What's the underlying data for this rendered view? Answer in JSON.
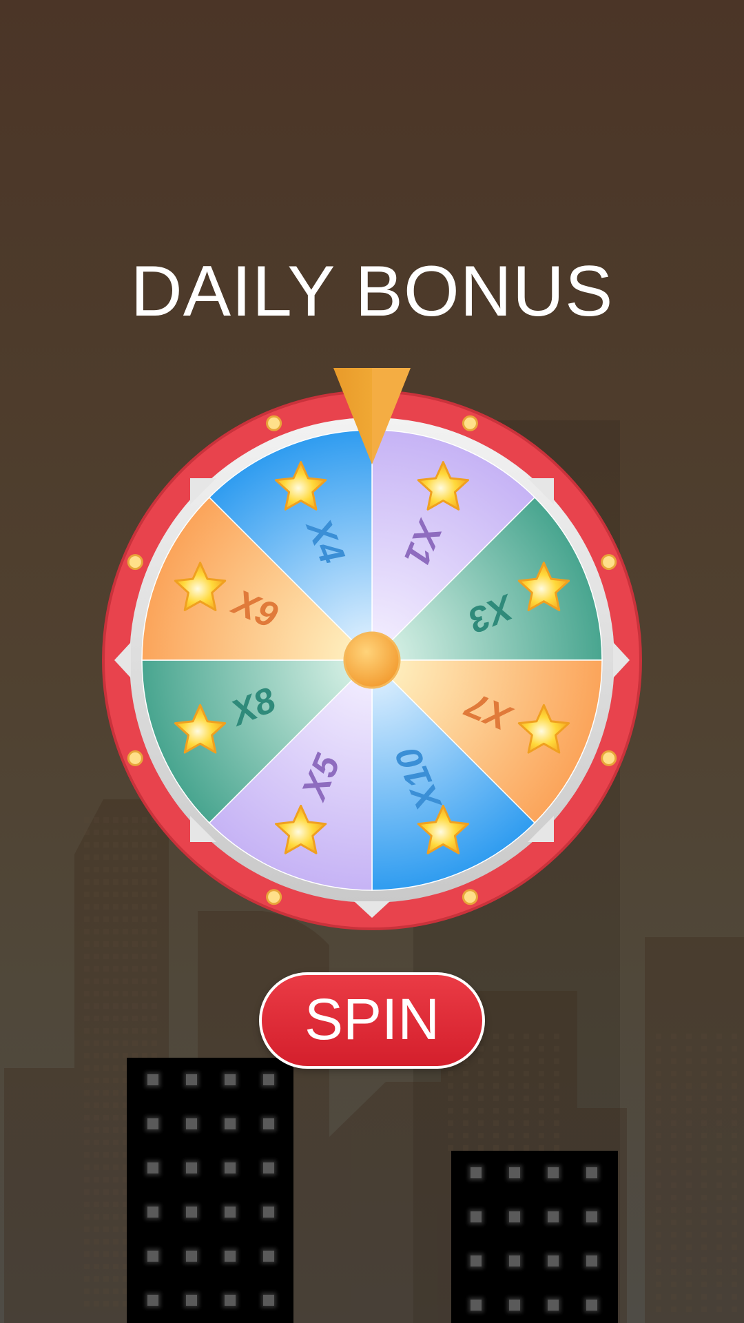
{
  "title": "DAILY BONUS",
  "spin_label": "SPIN",
  "wheel": {
    "segments": [
      {
        "label": "X1",
        "theme": "purple"
      },
      {
        "label": "X3",
        "theme": "green"
      },
      {
        "label": "X7",
        "theme": "orange"
      },
      {
        "label": "X10",
        "theme": "blue"
      },
      {
        "label": "X5",
        "theme": "purple"
      },
      {
        "label": "X8",
        "theme": "green"
      },
      {
        "label": "X9",
        "theme": "orange"
      },
      {
        "label": "X4",
        "theme": "blue"
      }
    ],
    "segment_icon": "star-icon",
    "pointer_icon": "pointer-icon"
  },
  "colors": {
    "rim": "#e8434d",
    "purple_text": "#8e6cbf",
    "green_text": "#2f8a7a",
    "orange_text": "#e07a3a",
    "blue_text": "#3b8fd6",
    "button": "#e02a36"
  }
}
